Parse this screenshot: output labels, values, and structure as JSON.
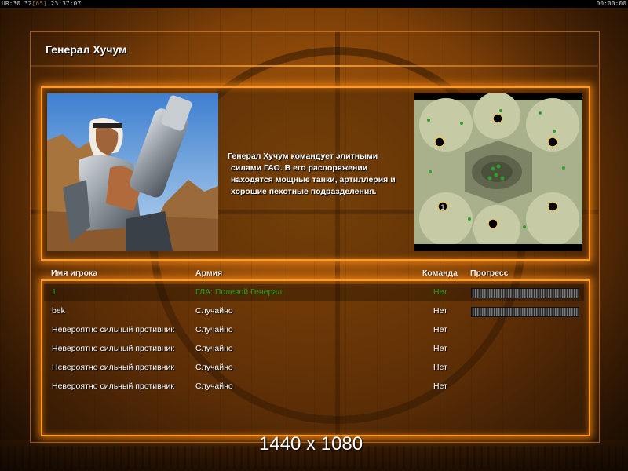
{
  "status_bar": {
    "left_text": "UR:30 32",
    "left_dim": "[65]",
    "left_time": "23:37:07",
    "right_text": "00:00:00"
  },
  "screen_title": "Генерал Хучум",
  "general": {
    "description_lines": [
      "Генерал Хучум командует элитными",
      "силами ГАО. В его распоряжении",
      "находятся мощные танки, артиллерия и",
      "хорошие пехотные подразделения."
    ]
  },
  "minimap": {
    "start_marker": "1"
  },
  "table": {
    "headers": {
      "player": "Имя игрока",
      "army": "Армия",
      "team": "Команда",
      "progress": "Прогресс"
    },
    "rows": [
      {
        "player": "1",
        "army": "ГЛА: Полевой Генерал",
        "team": "Нет",
        "progress": 0,
        "selected": true,
        "show_progress": true
      },
      {
        "player": "bek",
        "army": "Случайно",
        "team": "Нет",
        "progress": 0,
        "selected": false,
        "show_progress": true
      },
      {
        "player": "Невероятно сильный противник",
        "army": "Случайно",
        "team": "Нет",
        "selected": false,
        "show_progress": false
      },
      {
        "player": "Невероятно сильный противник",
        "army": "Случайно",
        "team": "Нет",
        "selected": false,
        "show_progress": false
      },
      {
        "player": "Невероятно сильный противник",
        "army": "Случайно",
        "team": "Нет",
        "selected": false,
        "show_progress": false
      },
      {
        "player": "Невероятно сильный противник",
        "army": "Случайно",
        "team": "Нет",
        "selected": false,
        "show_progress": false
      }
    ]
  },
  "resolution_label": "1440 x 1080",
  "colors": {
    "accent_orange": "#ff9a2a",
    "selected_text": "#1fa21a"
  }
}
